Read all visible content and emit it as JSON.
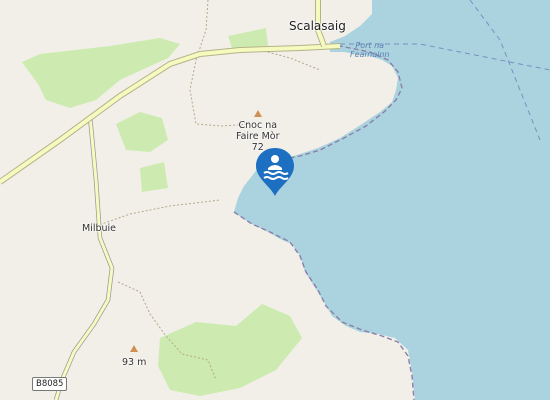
{
  "map": {
    "colors": {
      "land": "#f2efe9",
      "water": "#aad3df",
      "green": "#cdebb0",
      "road_major": "#f7fabf",
      "road_minor": "#ffffff",
      "track": "#b5a88a",
      "coast_dash": "#8a80a8",
      "marker": "#1d6fc1"
    },
    "labels": {
      "town": "Scalasaig",
      "hill_name_line1": "Cnoc na",
      "hill_name_line2": "Faire Mòr",
      "hill_elevation": "72",
      "village": "Milbuie",
      "peak_elevation": "93 m",
      "bay_line1": "Port na",
      "bay_line2": "Feamainn"
    },
    "road_ref": "B8085",
    "marker": {
      "type": "swimming",
      "icon": "swimming-icon"
    }
  }
}
